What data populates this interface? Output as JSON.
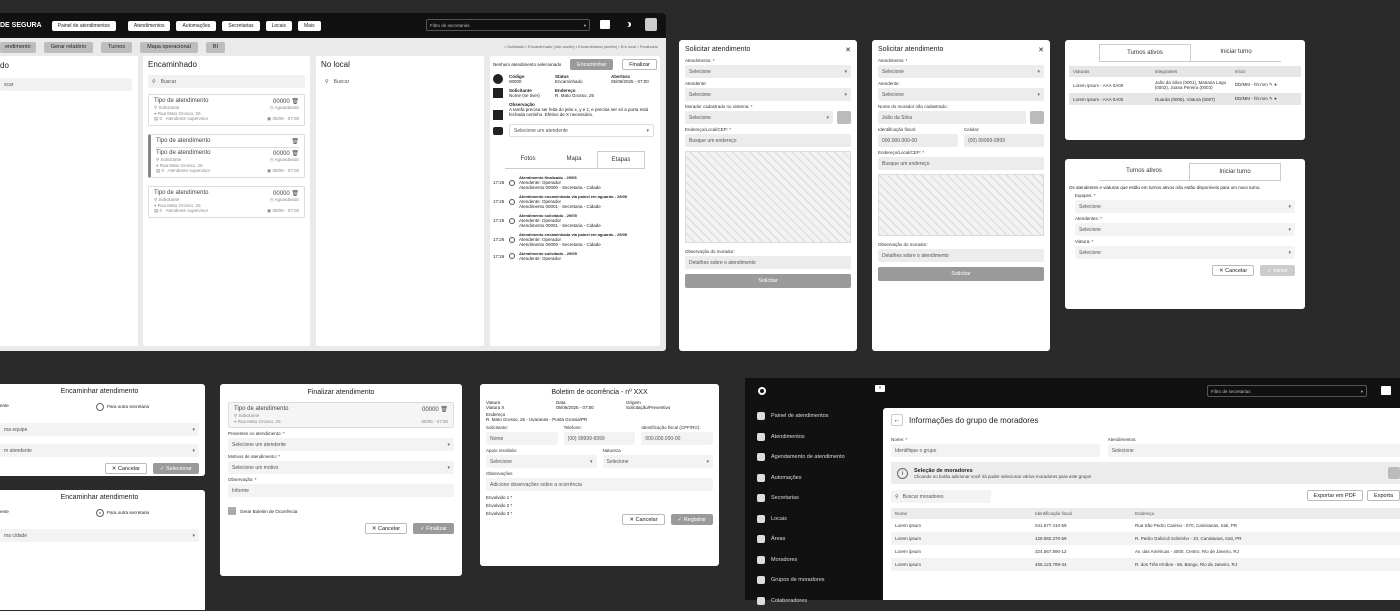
{
  "main": {
    "brand": "DE SEGURA",
    "nav": [
      "Painel de atendimentos",
      "Atendimentos",
      "Automações",
      "Secretarias",
      "Locais",
      "Mais"
    ],
    "filter_placeholder": "Filtro de secretarias",
    "toolbar": [
      "endimento",
      "Gerar relatório",
      "Turnos",
      "Mapa operacional",
      "BI"
    ],
    "legend": "• Solicitado  • Encaminhado (não aceito)  • Encaminhado (aceito)  • Em local  • Finalizado",
    "col_left_title": "do",
    "col_left_search": "scar",
    "col_mid_title": "Encaminhado",
    "col_right_title": "No local",
    "search": "Buscar",
    "card": {
      "type": "Tipo de atendimento",
      "num": "00000",
      "requester": "Solicitante",
      "status": "Aguardando",
      "street": "Rua Mato Grosso, 26",
      "count": "0",
      "supervisor": "Atendente supervisor",
      "date": "05/06 - 07:00"
    },
    "detail": {
      "none": "Nenhum atendimento selecionado",
      "btn_forward": "Encaminhar",
      "btn_finish": "Finalizar",
      "code_lbl": "Código",
      "code": "00000",
      "status_lbl": "Status",
      "status": "Encaminhado",
      "open_lbl": "Abertura",
      "open": "05/06/2025 - 07:00",
      "req_lbl": "Solicitante",
      "req": "Nome (se tiver)",
      "addr_lbl": "Endereço",
      "addr": "R. Mato Grosso, 26",
      "obs_lbl": "Observação",
      "obs": "A tarefa precisa ser feita do jeito x, y e z, e precisa ser só a porta está fechada certinho. Efetivo de X necessário.",
      "select_agent": "Selecione um atendente",
      "tabs": [
        "Fotos",
        "Mapa",
        "Etapas"
      ],
      "steps": [
        {
          "t": "17:26",
          "title": "Atendimento finalizado - 29/05",
          "l1": "Atendente: Operador",
          "l2": "Atendimento 00000 - Secretaria - Cidade"
        },
        {
          "t": "17:26",
          "title": "Atendimento encaminhado via painel em aguardo - 29/05",
          "l1": "Atendente: Operador",
          "l2": "Atendimento 00001 - Secretaria - Cidade"
        },
        {
          "t": "17:26",
          "title": "Atendimento solicitado - 29/05",
          "l1": "Atendente: Operador",
          "l2": "Atendimento 00001 - Secretaria - Cidade"
        },
        {
          "t": "17:26",
          "title": "Atendimento encaminhado via painel em aguardo - 29/05",
          "l1": "Atendente: Operador",
          "l2": "Atendimento 00000 - Secretaria - Cidade"
        },
        {
          "t": "17:26",
          "title": "Atendimento solicitado - 29/05",
          "l1": "Atendente: Operador",
          "l2": ""
        }
      ]
    }
  },
  "solicitar1": {
    "title": "Solicitar atendimento",
    "l_atend": "Atendimento: *",
    "v_atend": "Selecione",
    "l_agent": "Atendente:",
    "v_agent": "Selecione",
    "l_morador": "Morador cadastrado no sistema: *",
    "v_morador": "Selecione",
    "l_end": "Endereço/Local/CEP: *",
    "v_end": "Busque um endereço",
    "l_obs": "Observação do morador:",
    "v_obs": "Detalhes sobre o atendimento",
    "submit": "Solicitar"
  },
  "solicitar2": {
    "title": "Solicitar atendimento",
    "l_atend": "Atendimento: *",
    "v_atend": "Selecione",
    "l_agent": "Atendente:",
    "v_agent": "Selecione",
    "l_nome": "Nome do morador não cadastrado:",
    "v_nome": "João da Silva",
    "l_fiscal": "Identificação fiscal:",
    "v_fiscal": "000.000.000-00",
    "l_cel": "Celular:",
    "v_cel": "(00) 99999-9999",
    "l_end": "Endereço/Local/CEP: *",
    "v_end": "Busque um endereço",
    "l_obs": "Observação do morador:",
    "v_obs": "Detalhes sobre o atendimento",
    "submit": "Solicitar"
  },
  "turnos1": {
    "tabs": [
      "Turnos ativos",
      "Iniciar turno"
    ],
    "headers": [
      "Viaturas",
      "Integrantes",
      "Início"
    ],
    "rows": [
      {
        "v": "Lorem ipsum - AAA 0A00",
        "i": "João da Silva (0001), Mariana Lago (0002), Joana Pereira (0003)",
        "d": "DD/MM - hh:mm"
      },
      {
        "v": "Lorem ipsum - AAA 0A00",
        "i": "Guarda (0005), Viatura (0007)",
        "d": "DD/MM - hh:mm"
      }
    ]
  },
  "turnos2": {
    "tabs": [
      "Turnos ativos",
      "Iniciar turno"
    ],
    "info": "Os atendentes e viaturas que estão em turnos ativos não estão disponíveis para um novo turno.",
    "l_eq": "Equipes: *",
    "v_eq": "Selecione",
    "l_at": "Atendentes: *",
    "v_at": "Selecione",
    "l_vi": "Viatura: *",
    "v_vi": "Selecione",
    "cancel": "✕ Cancelar",
    "start": "✓ Iniciar"
  },
  "enc1": {
    "title": "Encaminhar atendimento",
    "l1": "ente",
    "opt": "Para outra secretaria",
    "v1": "ma equipe",
    "v2": "m atendente",
    "cancel": "✕ Cancelar",
    "ok": "✓ Selecionar"
  },
  "enc2": {
    "title": "Encaminhar atendimento",
    "l1": "ente",
    "opt": "Para outra secretaria",
    "v1": "ma cidade"
  },
  "fin": {
    "title": "Finalizar atendimento",
    "card_type": "Tipo de atendimento",
    "card_num": "00000",
    "card_req": "Solicitante",
    "card_street": "Rua Mato Grosso, 26",
    "card_date": "05/06 - 07:00",
    "l_pres": "Presentes no atendimento: *",
    "v_pres": "Selecione um atendente",
    "l_mot": "Motivos de atendimento: *",
    "v_mot": "Selecione um motivo",
    "l_obs": "Observação: *",
    "v_obs": "Informe",
    "chk": "Gerar Boletim de Ocorrência",
    "cancel": "✕ Cancelar",
    "ok": "✓ Finalizar"
  },
  "bo": {
    "title": "Boletim de ocorrência - nº XXX",
    "l_viat": "Viatura",
    "v_viat": "Viatura X",
    "l_data": "Data",
    "v_data": "05/06/2025 - 07:00",
    "l_orig": "Origem",
    "v_orig": "Solicitação/Preventivo",
    "l_end": "Endereço",
    "v_end": "R. Mato Grosso, 26 - Uvaranas - Ponta Grossa/PR",
    "l_sol": "Solicitante:",
    "v_sol": "Nome",
    "l_tel": "Telefone:",
    "v_tel": "(00) 99999-9999",
    "l_fis": "Identificação fiscal (CPF/RG):",
    "v_fis": "000.000.000-00",
    "l_apoio": "Apoio recebido:",
    "v_apoio": "Selecione",
    "l_nat": "Natureza",
    "v_nat": "Selecione",
    "l_obs": "Observações",
    "v_obs": "Adicione observações sobre a ocorrência",
    "env": [
      "Envolvido 1 *",
      "Envolvido 2 *",
      "Envolvido 3 *"
    ],
    "cancel": "✕ Cancelar",
    "ok": "✓ Registrar"
  },
  "grupo": {
    "sidebar": [
      "Painel de atendimentos",
      "Atendimentos",
      "Agendamento de atendimento",
      "Automações",
      "Secretarias",
      "Locais",
      "Áreas",
      "Moradores",
      "Grupos de moradores",
      "Colaboradores"
    ],
    "filter": "Filtro de secretarias",
    "title": "Informações do grupo de moradores",
    "l_nome": "Nome: *",
    "v_nome": "Identifique o grupo",
    "l_at": "Atendimentos:",
    "v_at": "Selecione",
    "sel_title": "Seleção de moradores",
    "sel_desc": "Clicando no botão adicionar você irá poder selecionar vários moradores para este grupo!",
    "search": "Buscar moradores",
    "export_pdf": "Exportar em PDF",
    "export2": "Exporta",
    "headers": [
      "Nome",
      "Identificação fiscal",
      "Endereço"
    ],
    "rows": [
      {
        "n": "Lorem ipsum",
        "f": "041.677.410-59",
        "e": "Rua São Pedro Canisio - 570, Canisianas, Irati, PR"
      },
      {
        "n": "Lorem ipsum",
        "f": "129.082.370-59",
        "e": "R. Pedro Galicioli Sobrinho - 10, Canisianas, Irati, PR"
      },
      {
        "n": "Lorem ipsum",
        "f": "324.567.890-12",
        "e": "Av. das Américas - 4000, Centro, Rio de Janeiro, RJ"
      },
      {
        "n": "Lorem ipsum",
        "f": "456.123.789-34",
        "e": "R. dos Três Irmãos - 66, Bangu, Rio de Janeiro, RJ"
      }
    ]
  }
}
